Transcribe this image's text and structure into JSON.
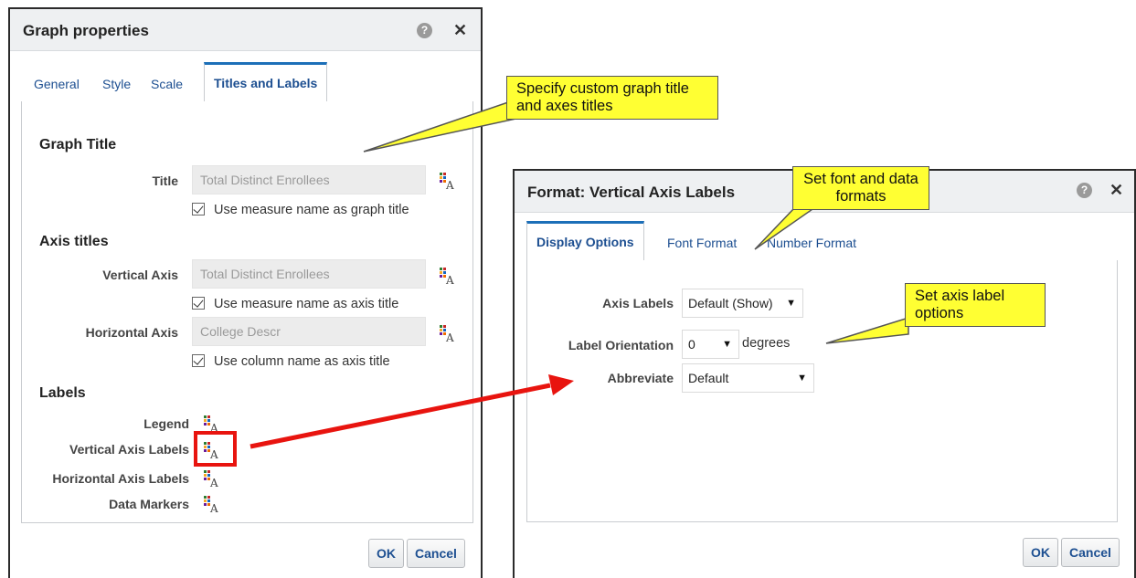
{
  "graph_properties": {
    "title": "Graph properties",
    "tabs": [
      {
        "label": "General",
        "active": false
      },
      {
        "label": "Style",
        "active": false
      },
      {
        "label": "Scale",
        "active": false
      },
      {
        "label": "Titles and Labels",
        "active": true
      }
    ],
    "graph_title_section": {
      "heading": "Graph Title",
      "title_label": "Title",
      "title_value": "Total Distinct Enrollees",
      "checkbox_label": "Use measure name as graph title",
      "checked": true
    },
    "axis_titles_section": {
      "heading": "Axis titles",
      "vertical_label": "Vertical Axis",
      "vertical_value": "Total Distinct Enrollees",
      "vertical_checkbox_label": "Use measure name as axis title",
      "horizontal_label": "Horizontal Axis",
      "horizontal_value": "College Descr",
      "horizontal_checkbox_label": "Use column name as axis title"
    },
    "labels_section": {
      "heading": "Labels",
      "items": [
        "Legend",
        "Vertical Axis Labels",
        "Horizontal Axis Labels",
        "Data Markers"
      ]
    },
    "ok_label": "OK",
    "cancel_label": "Cancel"
  },
  "format_dialog": {
    "title": "Format: Vertical Axis Labels",
    "tabs": [
      {
        "label": "Display Options",
        "active": true
      },
      {
        "label": "Font Format",
        "active": false
      },
      {
        "label": "Number Format",
        "active": false
      }
    ],
    "axis_labels_label": "Axis Labels",
    "axis_labels_value": "Default (Show)",
    "label_orientation_label": "Label Orientation",
    "label_orientation_value": "0",
    "orientation_unit": "degrees",
    "abbreviate_label": "Abbreviate",
    "abbreviate_value": "Default",
    "ok_label": "OK",
    "cancel_label": "Cancel"
  },
  "callouts": {
    "titles": "Specify custom graph title and axes titles",
    "fonts": "Set font and data formats",
    "axis_labels": "Set axis label options"
  },
  "colors": {
    "callout_fill": "#ffff33",
    "highlight": "#e8140f",
    "tab_accent": "#1c6fb8",
    "link_text": "#1d4f91"
  },
  "icons": {
    "help": "help-icon",
    "close": "close-icon",
    "format": "format-text-icon",
    "dropdown": "dropdown-arrow-icon"
  },
  "glyphs": {
    "help": "?",
    "close": "✕",
    "arrow": "▼"
  }
}
